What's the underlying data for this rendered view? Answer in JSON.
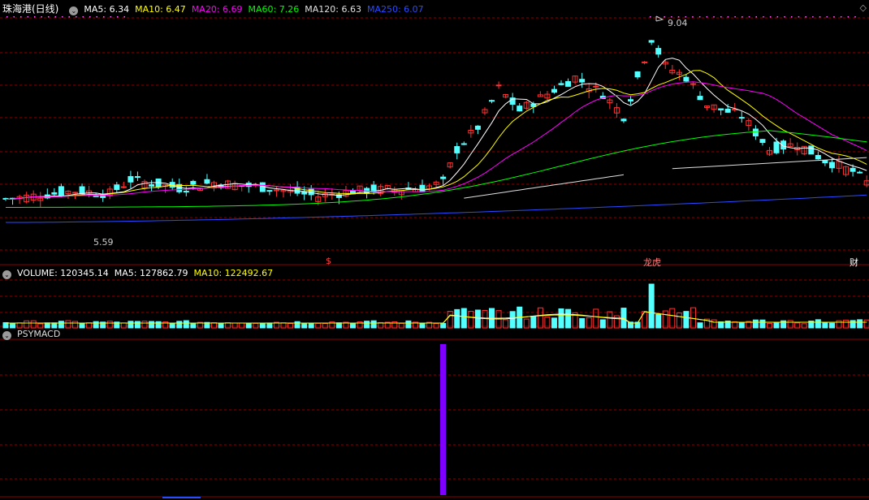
{
  "stock": {
    "title": "珠海港(日线)"
  },
  "main_indicators": [
    {
      "label": "MA5: 6.34",
      "color": "#ffffff"
    },
    {
      "label": "MA10: 6.47",
      "color": "#ffff00"
    },
    {
      "label": "MA20: 6.69",
      "color": "#ff00ff"
    },
    {
      "label": "MA60: 7.26",
      "color": "#00ff00"
    },
    {
      "label": "MA120: 6.63",
      "color": "#e0e0e0"
    },
    {
      "label": "MA250: 6.07",
      "color": "#2a4bff"
    }
  ],
  "volume_indicators": [
    {
      "label": "VOLUME: 120345.14",
      "color": "#ffffff"
    },
    {
      "label": "MA5: 127862.79",
      "color": "#ffffff"
    },
    {
      "label": "MA10: 122492.67",
      "color": "#ffff00"
    }
  ],
  "psy_panel": {
    "label": "PSYMACD"
  },
  "annotations": {
    "high": "9.04",
    "low": "5.59"
  },
  "markers": {
    "m1": "$",
    "m2": "龙虎",
    "m3": "财"
  },
  "colors": {
    "up": "#ff3232",
    "down": "#54ffff",
    "grid": "#8b0000",
    "psy_bar": "#8000ff"
  },
  "chart_data": {
    "type": "candlestick",
    "price_range": [
      5.2,
      9.3
    ],
    "high": 9.04,
    "low": 5.59,
    "ma_last": {
      "MA5": 6.34,
      "MA10": 6.47,
      "MA20": 6.69,
      "MA60": 7.26,
      "MA120": 6.63,
      "MA250": 6.07
    },
    "volume_last": 120345.14,
    "volume_ma": {
      "MA5": 127862.79,
      "MA10": 122492.67
    }
  }
}
